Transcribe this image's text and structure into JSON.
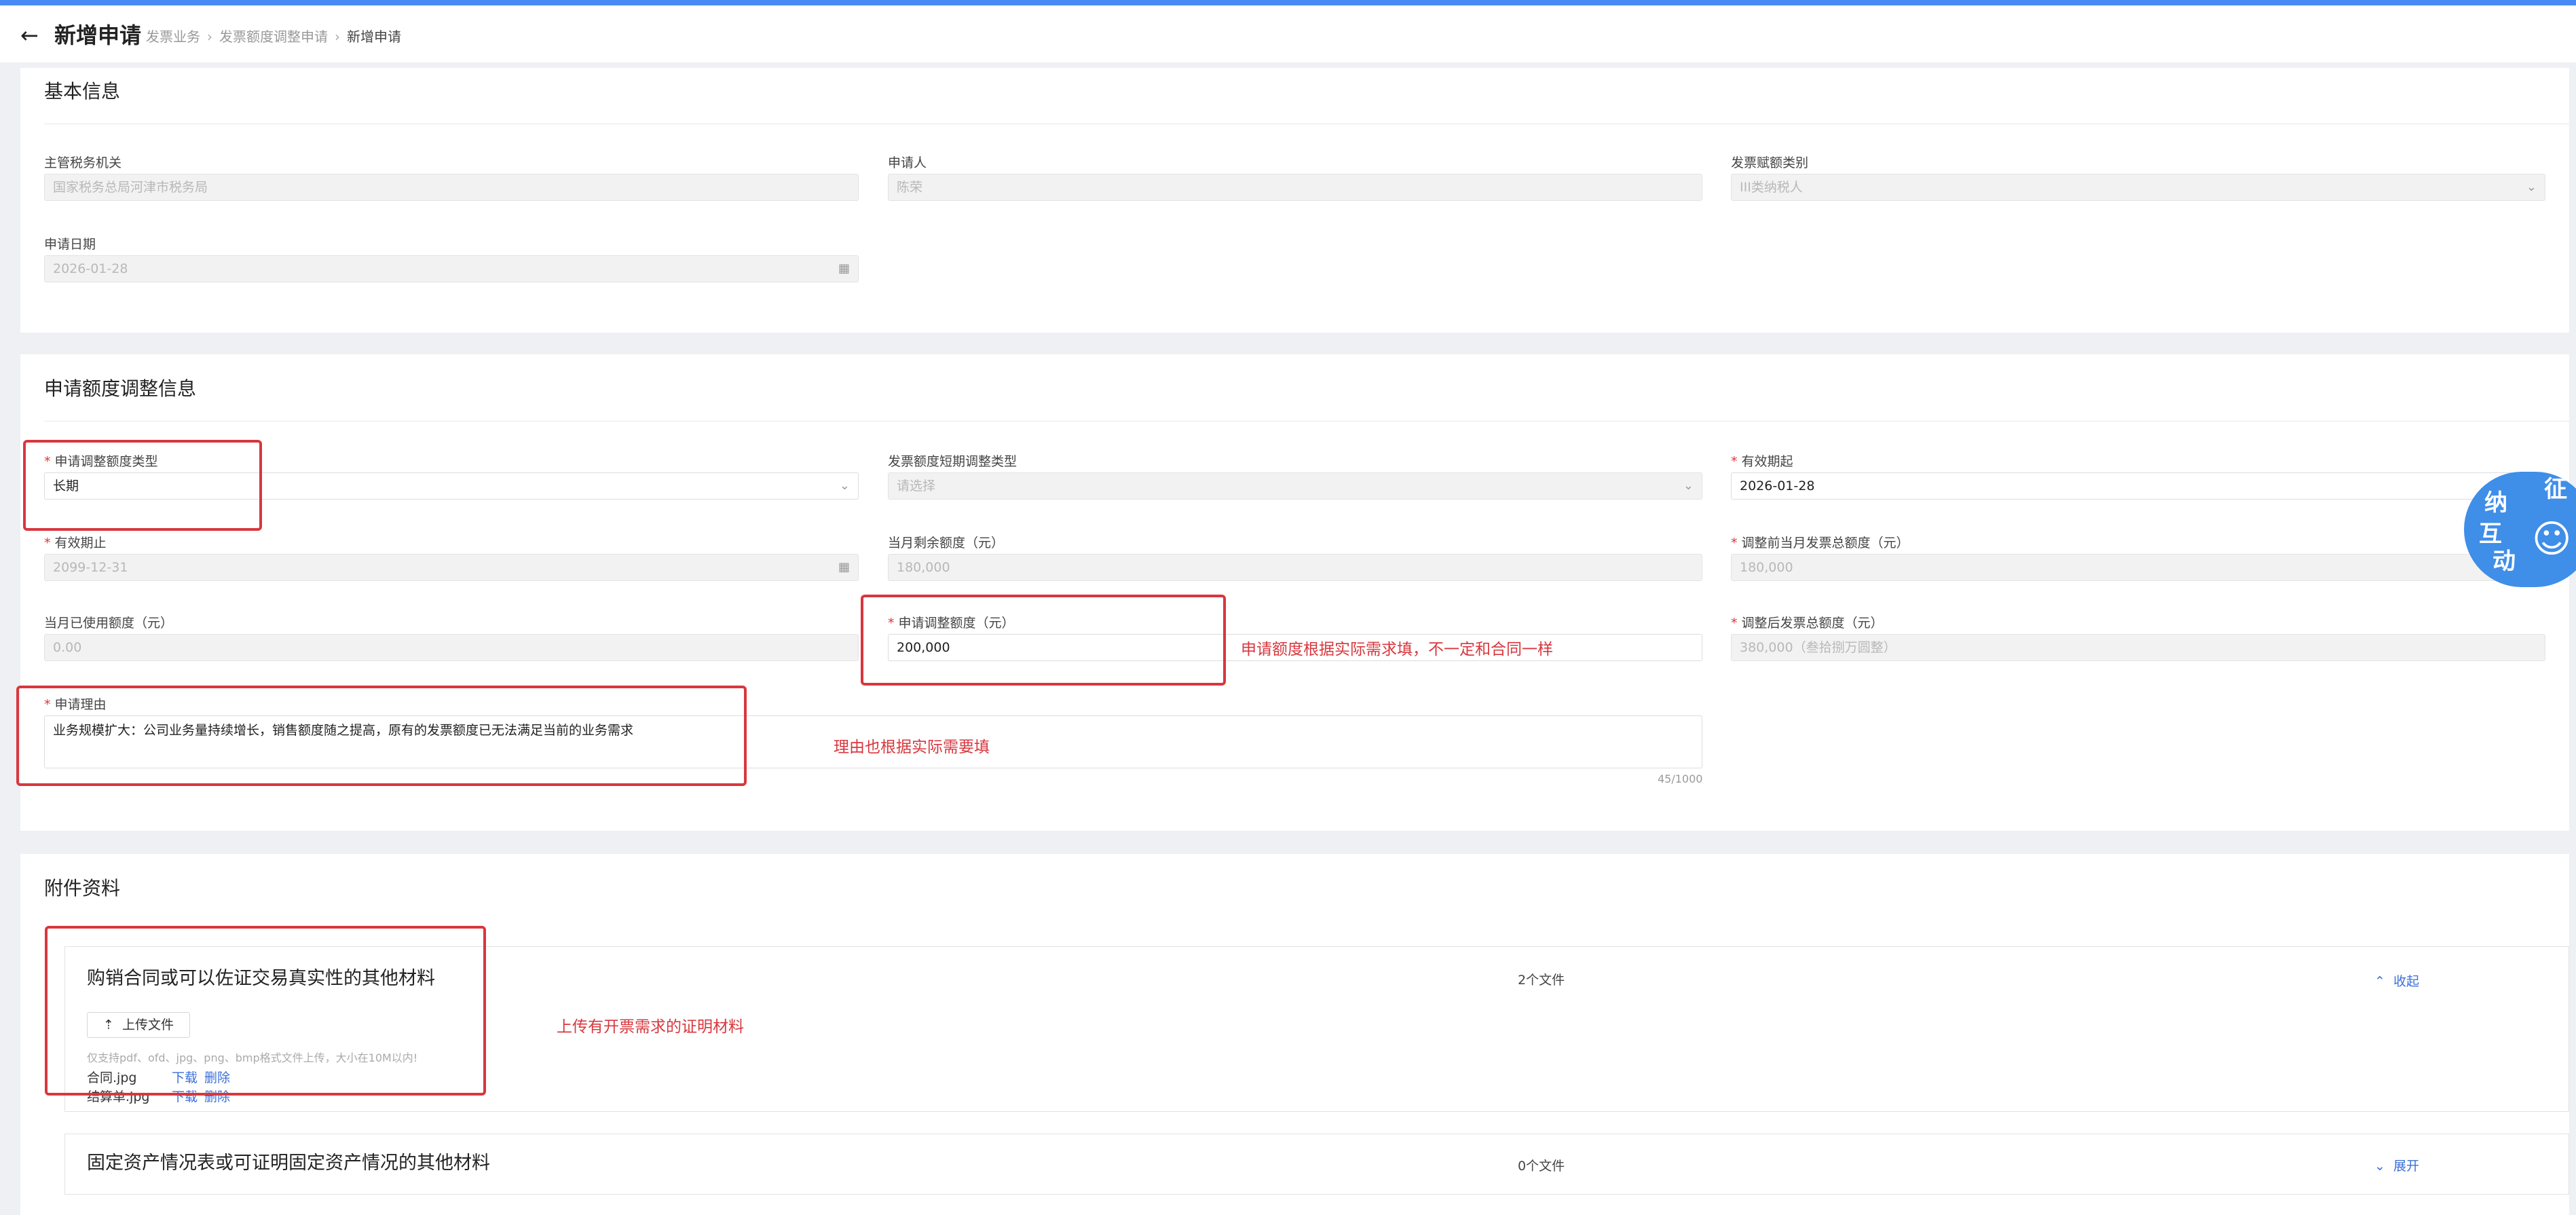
{
  "header": {
    "back_icon": "arrow-left-icon",
    "title": "新增申请",
    "breadcrumb": [
      "发票业务",
      "发票额度调整申请",
      "新增申请"
    ]
  },
  "basic": {
    "title": "基本信息",
    "tax_authority": {
      "label": "主管税务机关",
      "value": "国家税务总局河津市税务局"
    },
    "applicant": {
      "label": "申请人",
      "value": "陈荣"
    },
    "invoice_category": {
      "label": "发票赋额类别",
      "value": "III类纳税人"
    },
    "apply_date": {
      "label": "申请日期",
      "value": "2026-01-28"
    }
  },
  "adjust": {
    "title": "申请额度调整信息",
    "adjust_type": {
      "label": "申请调整额度类型",
      "value": "长期"
    },
    "short_term_type": {
      "label": "发票额度短期调整类型",
      "placeholder": "请选择"
    },
    "valid_from": {
      "label": "有效期起",
      "value": "2026-01-28"
    },
    "valid_to": {
      "label": "有效期止",
      "value": "2099-12-31"
    },
    "month_remaining": {
      "label": "当月剩余额度（元）",
      "value": "180,000"
    },
    "before_total": {
      "label": "调整前当月发票总额度（元）",
      "value": "180,000"
    },
    "month_used": {
      "label": "当月已使用额度（元）",
      "value": "0.00"
    },
    "adjust_amount": {
      "label": "申请调整额度（元）",
      "value": "200,000"
    },
    "after_total": {
      "label": "调整后发票总额度（元）",
      "value": "380,000（叁拾捌万圆整）"
    },
    "reason": {
      "label": "申请理由",
      "value": "业务规模扩大：公司业务量持续增长，销售额度随之提高，原有的发票额度已无法满足当前的业务需求",
      "count": "45/1000"
    }
  },
  "attachments": {
    "title": "附件资料",
    "groups": [
      {
        "title": "购销合同或可以佐证交易真实性的其他材料",
        "count": "2个文件",
        "toggle": "收起",
        "upload_label": "上传文件",
        "hint": "仅支持pdf、ofd、jpg、png、bmp格式文件上传，大小在10M以内!",
        "files": [
          {
            "name": "合同.jpg",
            "download": "下载",
            "delete": "删除"
          },
          {
            "name": "结算单.jpg",
            "download": "下载",
            "delete": "删除"
          }
        ]
      },
      {
        "title": "固定资产情况表或可证明固定资产情况的其他材料",
        "count": "0个文件",
        "toggle": "展开"
      }
    ]
  },
  "annotations": {
    "amount_note": "申请额度根据实际需求填，不一定和合同一样",
    "reason_note": "理由也根据实际需要填",
    "upload_note": "上传有开票需求的证明材料"
  },
  "badge": {
    "chars": [
      "征",
      "纳",
      "互",
      "动"
    ]
  },
  "colors": {
    "accent": "#4a8af4",
    "link": "#3b6fd8",
    "annotation": "#d8373e",
    "required": "#e0343a"
  }
}
